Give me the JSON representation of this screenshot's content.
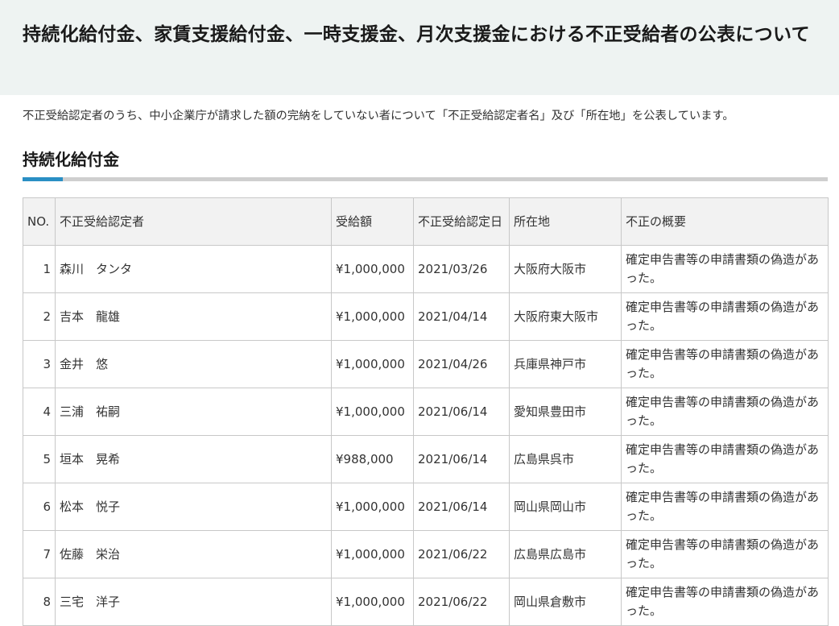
{
  "header": {
    "title": "持続化給付金、家賃支援給付金、一時支援金、月次支援金における不正受給者の公表について"
  },
  "intro": "不正受給認定者のうち、中小企業庁が請求した額の完納をしていない者について「不正受給認定者名」及び「所在地」を公表しています。",
  "section": {
    "heading": "持続化給付金",
    "accent_color": "#2a8fc4"
  },
  "table": {
    "columns": [
      "NO.",
      "不正受給認定者",
      "受給額",
      "不正受給認定日",
      "所在地",
      "不正の概要"
    ],
    "rows": [
      {
        "no": "1",
        "name": "森川　タンタ",
        "amount": "¥1,000,000",
        "date": "2021/03/26",
        "location": "大阪府大阪市",
        "summary": "確定申告書等の申請書類の偽造があった。"
      },
      {
        "no": "2",
        "name": "吉本　龍雄",
        "amount": "¥1,000,000",
        "date": "2021/04/14",
        "location": "大阪府東大阪市",
        "summary": "確定申告書等の申請書類の偽造があった。"
      },
      {
        "no": "3",
        "name": "金井　悠",
        "amount": "¥1,000,000",
        "date": "2021/04/26",
        "location": "兵庫県神戸市",
        "summary": "確定申告書等の申請書類の偽造があった。"
      },
      {
        "no": "4",
        "name": "三浦　祐嗣",
        "amount": "¥1,000,000",
        "date": "2021/06/14",
        "location": "愛知県豊田市",
        "summary": "確定申告書等の申請書類の偽造があった。"
      },
      {
        "no": "5",
        "name": "垣本　晃希",
        "amount": "¥988,000",
        "date": "2021/06/14",
        "location": "広島県呉市",
        "summary": "確定申告書等の申請書類の偽造があった。"
      },
      {
        "no": "6",
        "name": "松本　悦子",
        "amount": "¥1,000,000",
        "date": "2021/06/14",
        "location": "岡山県岡山市",
        "summary": "確定申告書等の申請書類の偽造があった。"
      },
      {
        "no": "7",
        "name": "佐藤　栄治",
        "amount": "¥1,000,000",
        "date": "2021/06/22",
        "location": "広島県広島市",
        "summary": "確定申告書等の申請書類の偽造があった。"
      },
      {
        "no": "8",
        "name": "三宅　洋子",
        "amount": "¥1,000,000",
        "date": "2021/06/22",
        "location": "岡山県倉敷市",
        "summary": "確定申告書等の申請書類の偽造があった。"
      }
    ]
  }
}
